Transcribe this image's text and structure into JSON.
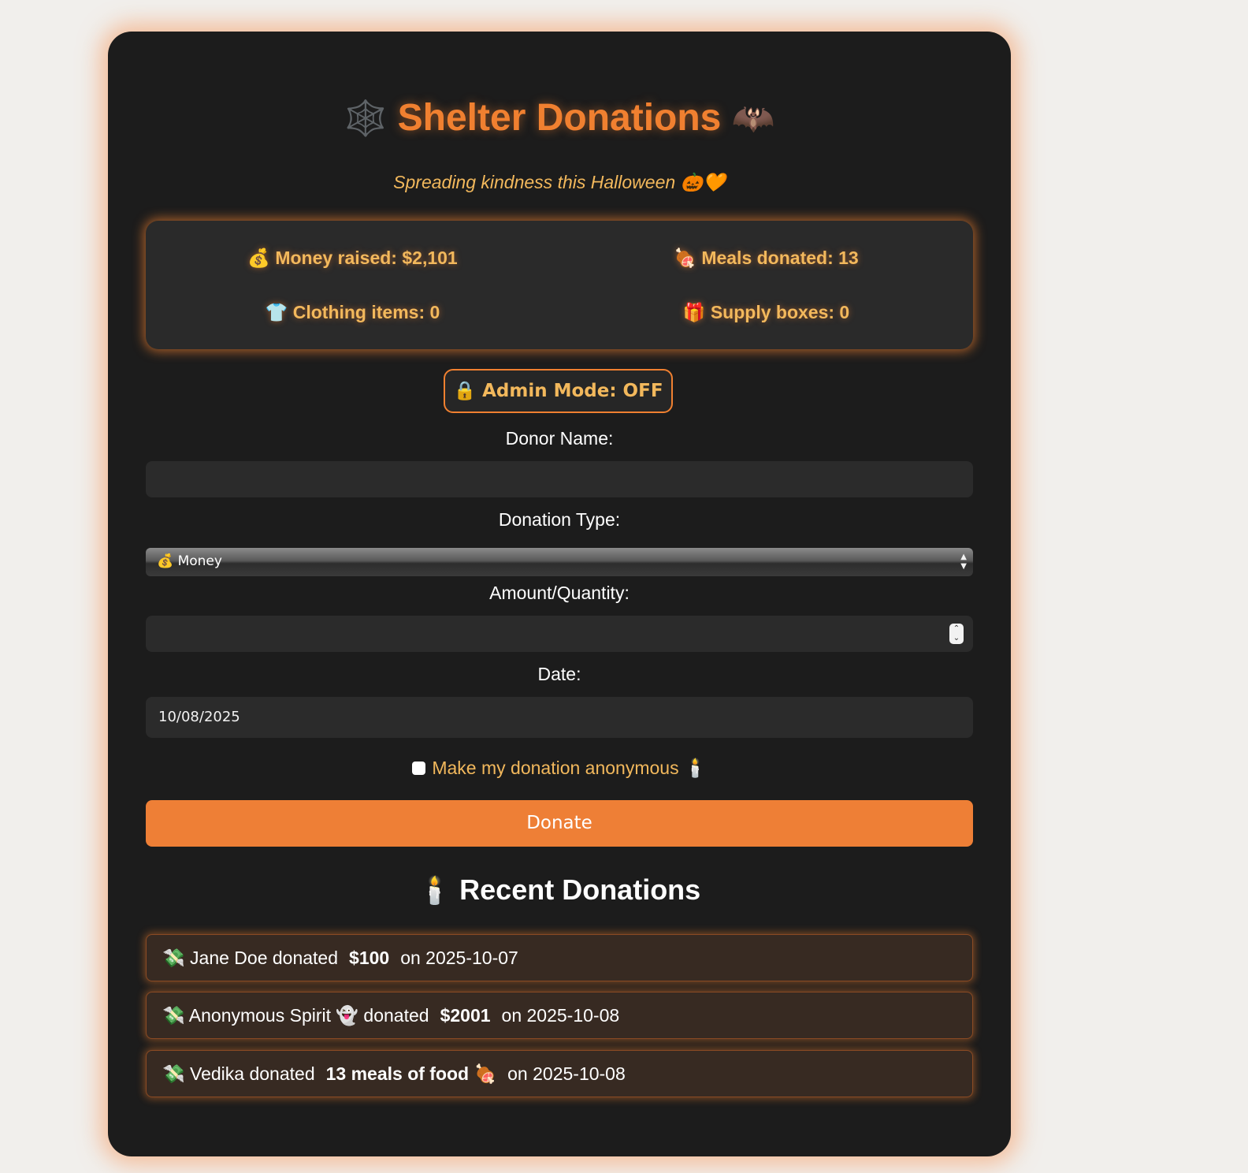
{
  "header": {
    "title": "Shelter Donations",
    "title_left_icon": "🕸️",
    "title_right_icon": "🦇",
    "subtitle": "Spreading kindness this Halloween 🎃🧡"
  },
  "stats": {
    "money_icon": "💰",
    "money": "Money raised: $2,101",
    "meals_icon": "🍖",
    "meals": "Meals donated: 13",
    "clothing_icon": "👕",
    "clothing": "Clothing items: 0",
    "supplies_icon": "🎁",
    "supplies": "Supply boxes: 0"
  },
  "admin": {
    "icon": "🔒",
    "label": "Admin Mode: OFF"
  },
  "form": {
    "donor_name_label": "Donor Name:",
    "donor_name_value": "",
    "donation_type_label": "Donation Type:",
    "donation_type_icon": "💰",
    "donation_type_value": "Money",
    "amount_label": "Amount/Quantity:",
    "amount_value": "",
    "date_label": "Date:",
    "date_value": "10/08/2025",
    "anonymous_label": "Make my donation anonymous 🕯️",
    "donate_label": "Donate"
  },
  "recent": {
    "icon": "🕯️",
    "title": "Recent Donations",
    "items": [
      {
        "icon": "💸",
        "prefix": "Jane Doe donated",
        "amount": "$100",
        "suffix": "on 2025-10-07"
      },
      {
        "icon": "💸",
        "prefix": "Anonymous Spirit 👻 donated",
        "amount": "$2001",
        "suffix": "on 2025-10-08"
      },
      {
        "icon": "💸",
        "prefix": "Vedika donated",
        "amount": "13 meals of food 🍖",
        "suffix": "on 2025-10-08"
      }
    ]
  },
  "colors": {
    "accent": "#ee7f36",
    "gold": "#f2b85c",
    "card": "#1c1c1c",
    "page": "#f1efec"
  }
}
